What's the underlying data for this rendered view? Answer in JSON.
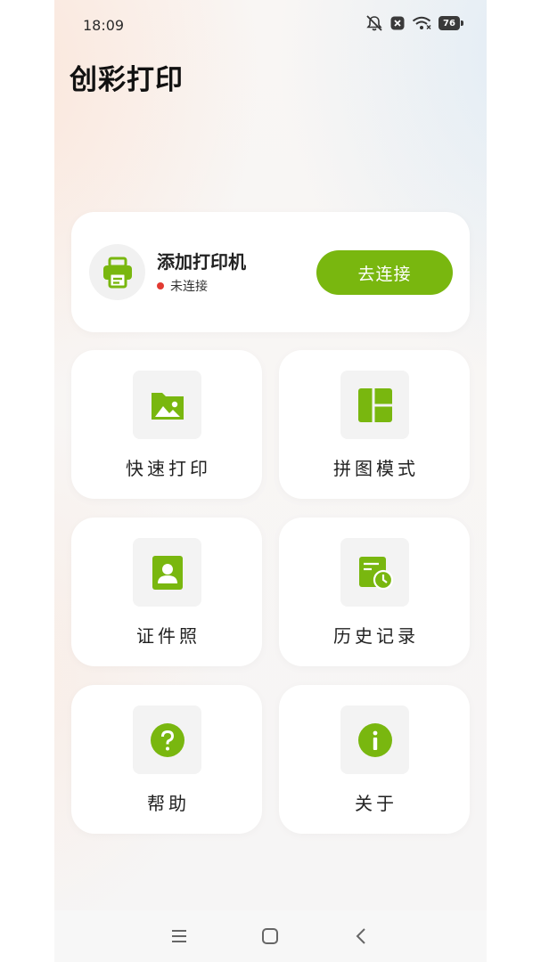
{
  "status_bar": {
    "time": "18:09",
    "battery_level": "76",
    "icons": [
      "mute-icon",
      "notification-icon",
      "wifi-icon",
      "battery-icon"
    ]
  },
  "app": {
    "title": "创彩打印"
  },
  "printer_card": {
    "name": "添加打印机",
    "status": "未连接",
    "status_color": "#e23a32",
    "connect_label": "去连接",
    "icon": "printer-icon"
  },
  "tiles": [
    {
      "label": "快速打印",
      "icon": "image-icon"
    },
    {
      "label": "拼图模式",
      "icon": "layout-grid-icon"
    },
    {
      "label": "证件照",
      "icon": "id-photo-icon"
    },
    {
      "label": "历史记录",
      "icon": "history-icon"
    },
    {
      "label": "帮助",
      "icon": "help-icon"
    },
    {
      "label": "关于",
      "icon": "info-icon"
    }
  ],
  "nav_bar": {
    "buttons": [
      "menu-icon",
      "home-icon",
      "back-icon"
    ]
  },
  "colors": {
    "accent": "#79b70f",
    "icon_bg": "#f3f3f3",
    "card_bg": "#ffffff"
  }
}
